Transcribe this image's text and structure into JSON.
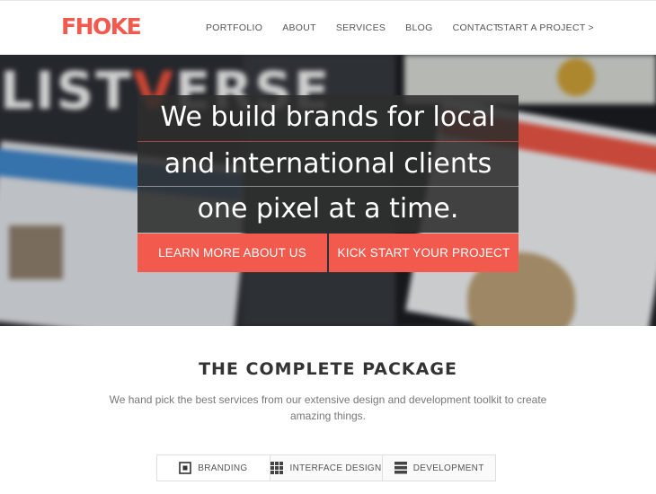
{
  "header": {
    "logo": "FHOKE",
    "nav": [
      "PORTFOLIO",
      "ABOUT",
      "SERVICES",
      "BLOG",
      "CONTACT"
    ],
    "cta": "START A PROJECT >"
  },
  "hero": {
    "background_text": "LISTVERSE",
    "headline_lines": [
      "We build brands for local",
      "and international clients",
      "one pixel at a time."
    ],
    "buttons": [
      "LEARN MORE ABOUT US",
      "KICK START YOUR PROJECT"
    ]
  },
  "section": {
    "title": "THE COMPLETE PACKAGE",
    "description": "We hand pick the best services from our extensive design and development toolkit to create amazing things."
  },
  "tabs": [
    {
      "label": "BRANDING",
      "icon": "branding-square-icon",
      "active": true
    },
    {
      "label": "INTERFACE DESIGN",
      "icon": "grid-icon",
      "active": false
    },
    {
      "label": "DEVELOPMENT",
      "icon": "stack-bars-icon",
      "active": false
    }
  ],
  "colors": {
    "accent": "#f25a4e",
    "headline_bg": "#2d2d2d",
    "text_dark": "#333333",
    "text_muted": "#777777"
  }
}
